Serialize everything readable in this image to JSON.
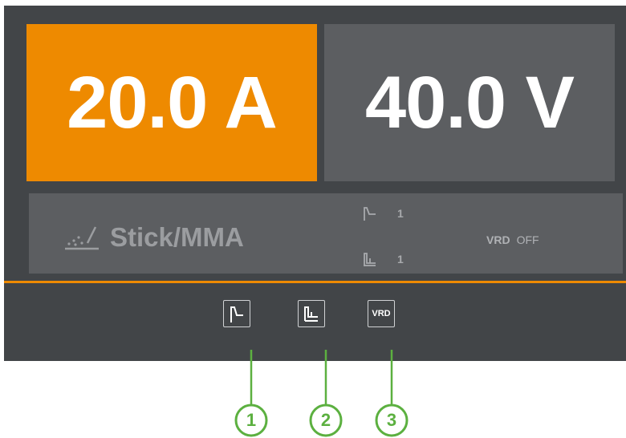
{
  "readouts": {
    "current": "20.0 A",
    "voltage": "40.0 V"
  },
  "mode": {
    "label": "Stick/MMA",
    "icon": "stick-electrode-icon"
  },
  "params": [
    {
      "icon": "hot-start-icon",
      "value": "1"
    },
    {
      "icon": "arc-force-icon",
      "value": "1"
    }
  ],
  "vrd_status": {
    "label": "VRD",
    "value": "OFF"
  },
  "buttons": [
    {
      "icon": "hot-start-icon"
    },
    {
      "icon": "arc-force-icon"
    },
    {
      "label": "VRD"
    }
  ],
  "callouts": [
    "1",
    "2",
    "3"
  ],
  "colors": {
    "accent": "#ee8a00",
    "panel": "#424548",
    "box": "#5c5e61",
    "callout": "#5cb040"
  }
}
